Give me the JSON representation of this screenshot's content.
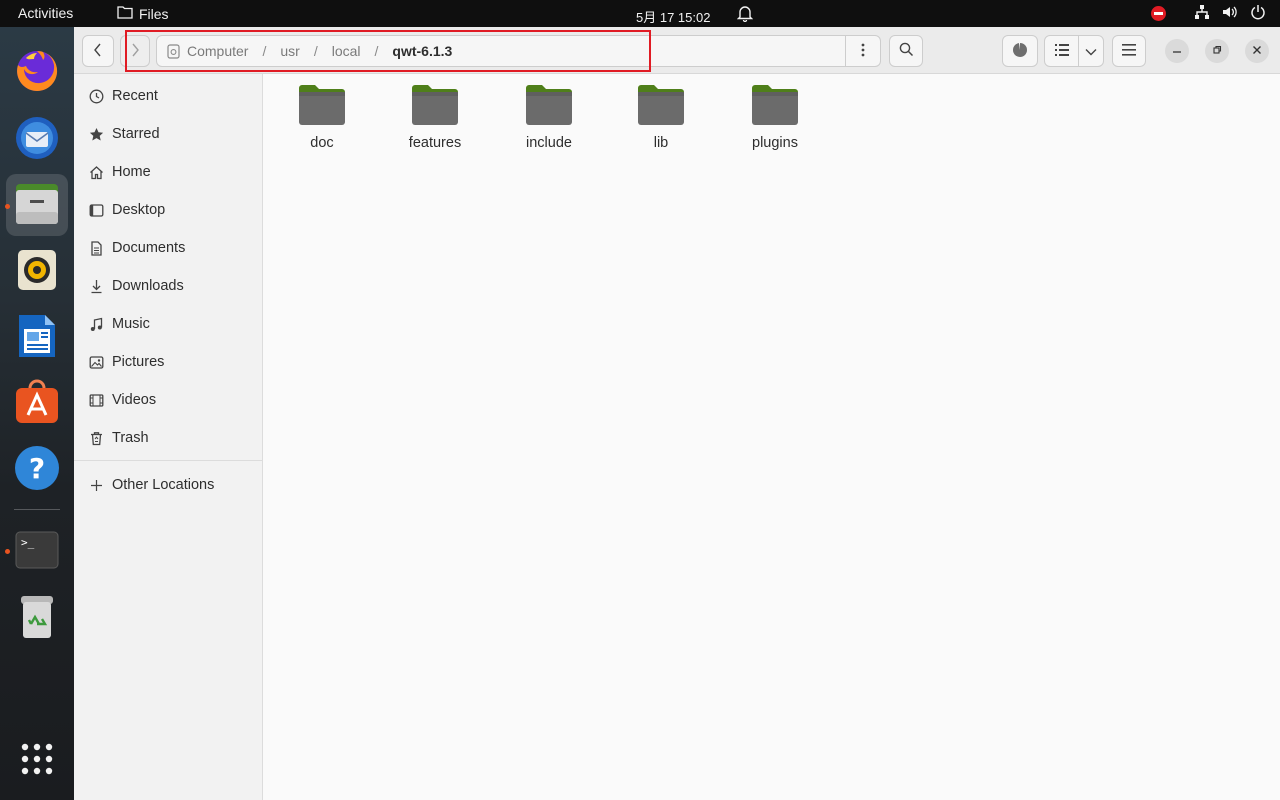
{
  "topbar": {
    "activities": "Activities",
    "app_name": "Files",
    "clock": "5月 17  15:02"
  },
  "dock": {
    "apps": [
      {
        "name": "Firefox",
        "icon": "firefox-icon"
      },
      {
        "name": "Thunderbird",
        "icon": "thunderbird-icon"
      },
      {
        "name": "Files",
        "icon": "files-icon",
        "active": true
      },
      {
        "name": "Rhythmbox",
        "icon": "rhythmbox-icon"
      },
      {
        "name": "LibreOffice Writer",
        "icon": "writer-icon"
      },
      {
        "name": "Ubuntu Software",
        "icon": "software-icon"
      },
      {
        "name": "Help",
        "icon": "help-icon"
      },
      {
        "name": "Terminal",
        "icon": "terminal-icon"
      },
      {
        "name": "Trash",
        "icon": "trash-icon"
      },
      {
        "name": "Show Applications",
        "icon": "app-grid-icon"
      }
    ],
    "terminal_prompt": ">_",
    "help_glyph": "?"
  },
  "pathbar": {
    "crumbs": [
      "Computer",
      "usr",
      "local",
      "qwt-6.1.3"
    ],
    "separator": "/"
  },
  "sidebar": {
    "items": [
      {
        "label": "Recent",
        "icon": "clock-icon"
      },
      {
        "label": "Starred",
        "icon": "star-icon"
      },
      {
        "label": "Home",
        "icon": "home-icon"
      },
      {
        "label": "Desktop",
        "icon": "desktop-icon"
      },
      {
        "label": "Documents",
        "icon": "document-icon"
      },
      {
        "label": "Downloads",
        "icon": "download-icon"
      },
      {
        "label": "Music",
        "icon": "music-icon"
      },
      {
        "label": "Pictures",
        "icon": "picture-icon"
      },
      {
        "label": "Videos",
        "icon": "video-icon"
      },
      {
        "label": "Trash",
        "icon": "trash-icon"
      }
    ],
    "other_locations": {
      "label": "Other Locations",
      "icon": "plus-icon"
    }
  },
  "folders": [
    "doc",
    "features",
    "include",
    "lib",
    "plugins"
  ],
  "colors": {
    "folder_top": "#5a8a1f",
    "folder_body": "#6b6b6b",
    "highlight": "#e01b24",
    "accent": "#e95420"
  }
}
